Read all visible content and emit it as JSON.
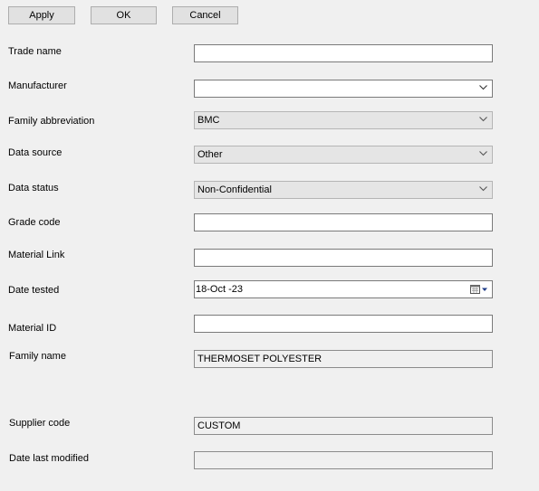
{
  "toolbar": {
    "apply_label": "Apply",
    "ok_label": "OK",
    "cancel_label": "Cancel"
  },
  "form": {
    "trade_name": {
      "label": "Trade name",
      "value": ""
    },
    "manufacturer": {
      "label": "Manufacturer",
      "value": ""
    },
    "family_abbreviation": {
      "label": "Family abbreviation",
      "value": "BMC"
    },
    "data_source": {
      "label": "Data source",
      "value": "Other"
    },
    "data_status": {
      "label": "Data status",
      "value": "Non-Confidential"
    },
    "grade_code": {
      "label": "Grade code",
      "value": ""
    },
    "material_link": {
      "label": "Material Link",
      "value": ""
    },
    "date_tested": {
      "label": "Date tested",
      "value": "18-Oct -23"
    },
    "material_id": {
      "label": "Material ID",
      "value": ""
    },
    "family_name": {
      "label": "Family name",
      "value": "THERMOSET POLYESTER"
    },
    "supplier_code": {
      "label": "Supplier code",
      "value": "CUSTOM"
    },
    "date_last_modified": {
      "label": "Date last modified",
      "value": ""
    }
  },
  "icons": {
    "dropdown": "chevron-down-icon",
    "calendar": "calendar-icon"
  },
  "colors": {
    "window_background": "#f0f0f0",
    "button_background": "#e1e1e1",
    "field_border": "#7a7a7a",
    "disabled_combo_background": "#e5e5e5"
  }
}
